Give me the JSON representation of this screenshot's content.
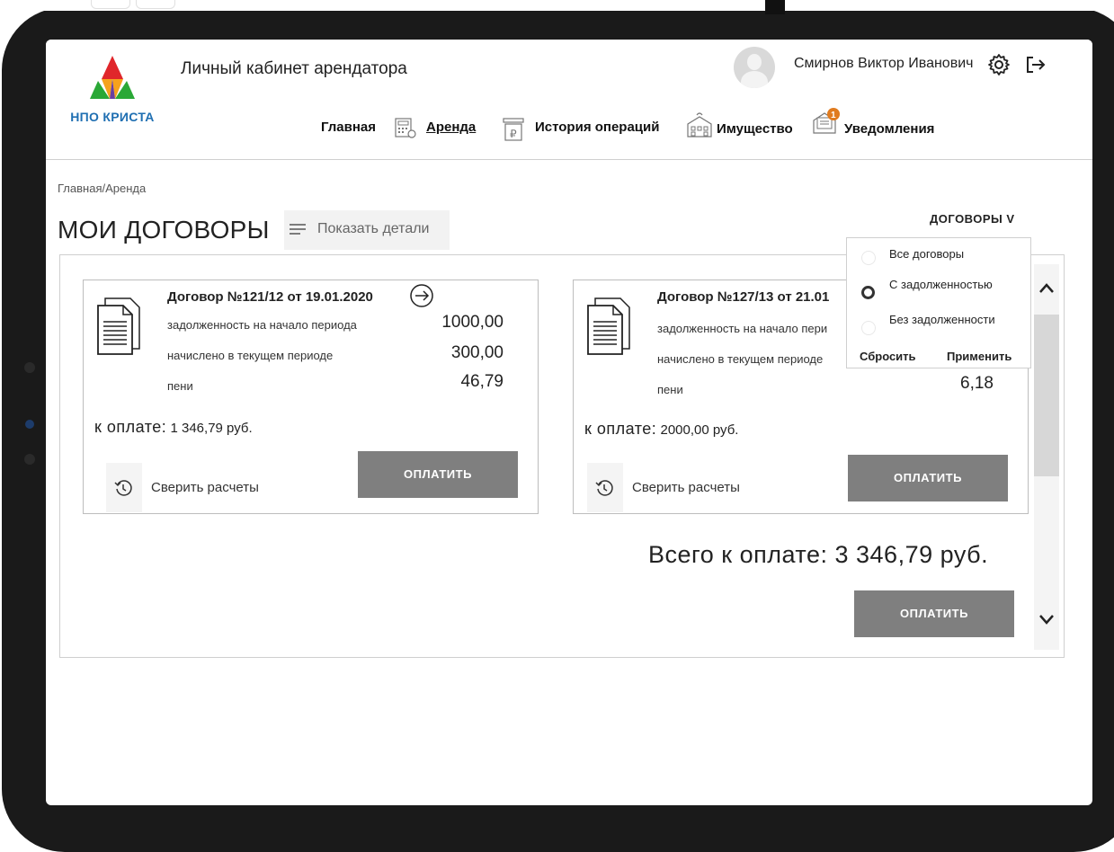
{
  "app": {
    "logo_text": "НПО КРИСТА",
    "title": "Личный кабинет арендатора"
  },
  "user": {
    "name": "Смирнов Виктор Иванович"
  },
  "nav": {
    "items": [
      {
        "label": "Главная",
        "icon": "none"
      },
      {
        "label": "Аренда",
        "icon": "calculator-icon",
        "active": true
      },
      {
        "label": "История операций",
        "icon": "ruble-receipt-icon"
      },
      {
        "label": "Имущество",
        "icon": "building-icon"
      },
      {
        "label": "Уведомления",
        "icon": "notification-icon",
        "badge": "1"
      }
    ]
  },
  "breadcrumb": "Главная/Аренда",
  "page_title": "МОИ ДОГОВОРЫ",
  "details_label": "Показать детали",
  "filter": {
    "toggle_label": "ДОГОВОРЫ  V",
    "options": [
      {
        "label": "Все договоры",
        "selected": false
      },
      {
        "label": "С задолженностью",
        "selected": true
      },
      {
        "label": "Без задолженности",
        "selected": false
      }
    ],
    "reset_label": "Сбросить",
    "apply_label": "Применить"
  },
  "contracts": [
    {
      "title": "Договор №121/12 от 19.01.2020",
      "rows": [
        {
          "label": "задолженность на начало периода",
          "value": "1000,00"
        },
        {
          "label": "начислено в текущем периоде",
          "value": "300,00"
        },
        {
          "label": "пени",
          "value": "46,79"
        }
      ],
      "to_pay_label": "к оплате:",
      "to_pay_value": "1 346,79 руб.",
      "reconcile_label": "Сверить расчеты",
      "pay_label": "ОПЛАТИТЬ"
    },
    {
      "title": "Договор №127/13 от 21.01",
      "rows": [
        {
          "label": "задолженность на начало пери",
          "value": ""
        },
        {
          "label": "начислено в текущем периоде",
          "value": ""
        },
        {
          "label": "пени",
          "value": "6,18"
        }
      ],
      "to_pay_label": "к оплате:",
      "to_pay_value": "2000,00 руб.",
      "reconcile_label": "Сверить расчеты",
      "pay_label": "ОПЛАТИТЬ"
    }
  ],
  "total": {
    "text": "Всего к оплате: 3 346,79 руб.",
    "pay_label": "ОПЛАТИТЬ"
  },
  "colors": {
    "button_bg": "#7f7f7f",
    "badge": "#e07b1f",
    "logo_blue": "#1f6fb2"
  }
}
